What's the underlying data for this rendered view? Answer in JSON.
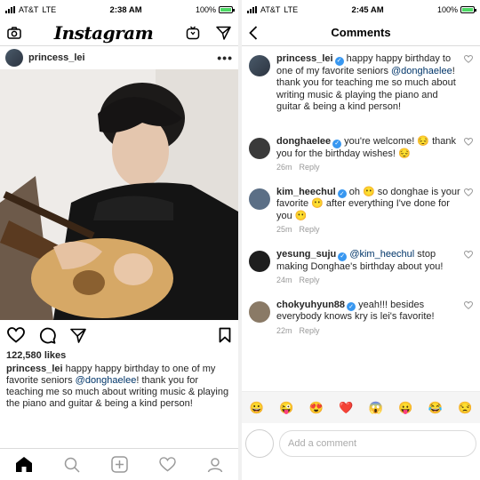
{
  "left": {
    "status": {
      "carrier": "AT&T",
      "network": "LTE",
      "time": "2:38 AM",
      "battery": "100%",
      "battery_level": 1.0
    },
    "header": {
      "logo": "Instagram",
      "icons": [
        "camera-icon",
        "igtv-icon",
        "direct-message-icon"
      ]
    },
    "post": {
      "username": "princess_lei",
      "more": "•••",
      "likes": "122,580 likes",
      "caption_user": "princess_lei",
      "caption_text_1": " happy happy birthday to one of my favorite seniors ",
      "caption_mention": "@donghaelee",
      "caption_text_2": "! thank you for teaching me so much about writing music & playing the piano and guitar & being a kind person!"
    },
    "tabbar": [
      "home-icon",
      "search-icon",
      "add-post-icon",
      "activity-heart-icon",
      "profile-icon"
    ]
  },
  "right": {
    "status": {
      "carrier": "AT&T",
      "network": "LTE",
      "time": "2:45 AM",
      "battery": "100%",
      "battery_level": 1.0
    },
    "title": "Comments",
    "caption": {
      "username": "princess_lei",
      "text_1": " happy happy birthday to one of my favorite seniors ",
      "mention": "@donghaelee",
      "text_2": "! thank you for teaching me so much about writing music & playing the piano and guitar & being a kind person!"
    },
    "comments": [
      {
        "username": "donghaelee",
        "text": " you're welcome! 😔 thank you for the birthday wishes! 😔",
        "time": "26m",
        "reply": "Reply",
        "color": "#3a3a3a"
      },
      {
        "username": "kim_heechul",
        "text": " oh 😶 so donghae is your favorite 😶 after everything I've done for you 😶",
        "time": "25m",
        "reply": "Reply",
        "color": "#5b6f86"
      },
      {
        "username": "yesung_suju",
        "text_pre": " ",
        "mention": "@kim_heechul",
        "text": " stop making Donghae's birthday about you!",
        "time": "24m",
        "reply": "Reply",
        "color": "#1e1e1e"
      },
      {
        "username": "chokyuhyun88",
        "text": " yeah!!! besides everybody knows kry is lei's favorite!",
        "time": "22m",
        "reply": "Reply",
        "color": "#8a7a66"
      }
    ],
    "emojis": [
      "😀",
      "😜",
      "😍",
      "❤️",
      "😱",
      "😛",
      "😂",
      "😒"
    ],
    "input_placeholder": "Add a comment"
  }
}
